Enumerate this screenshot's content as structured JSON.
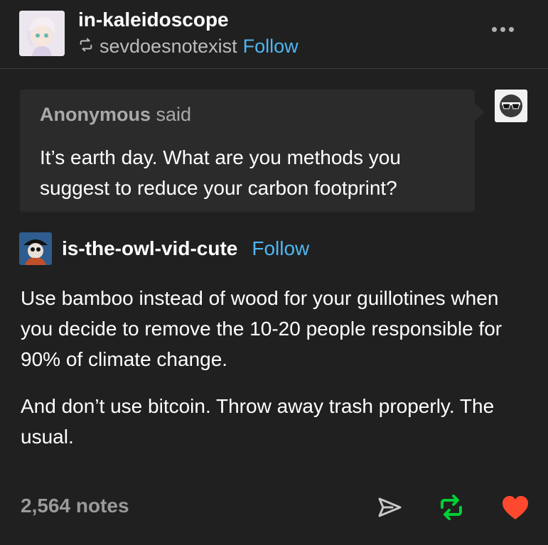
{
  "post": {
    "blog_name": "in-kaleidoscope",
    "reblogged_from": "sevdoesnotexist",
    "follow_label": "Follow"
  },
  "ask": {
    "asker": "Anonymous",
    "said": "said",
    "question": "It’s earth day. What are you methods you suggest to reduce your carbon footprint?"
  },
  "answer": {
    "blog_name": "is-the-owl-vid-cute",
    "follow_label": "Follow",
    "paragraphs": [
      "Use bamboo instead of wood for your guillotines when you decide to remove the 10-20 people responsible for 90% of climate change.",
      "And don’t use bitcoin. Throw away trash properly. The usual."
    ]
  },
  "footer": {
    "notes": "2,564 notes"
  },
  "colors": {
    "background": "#202020",
    "link": "#4fb6f2",
    "reblog_green": "#00cf35",
    "like_red": "#ff492f"
  },
  "icons": [
    "reblog-icon",
    "more-icon",
    "share-icon",
    "like-icon"
  ]
}
